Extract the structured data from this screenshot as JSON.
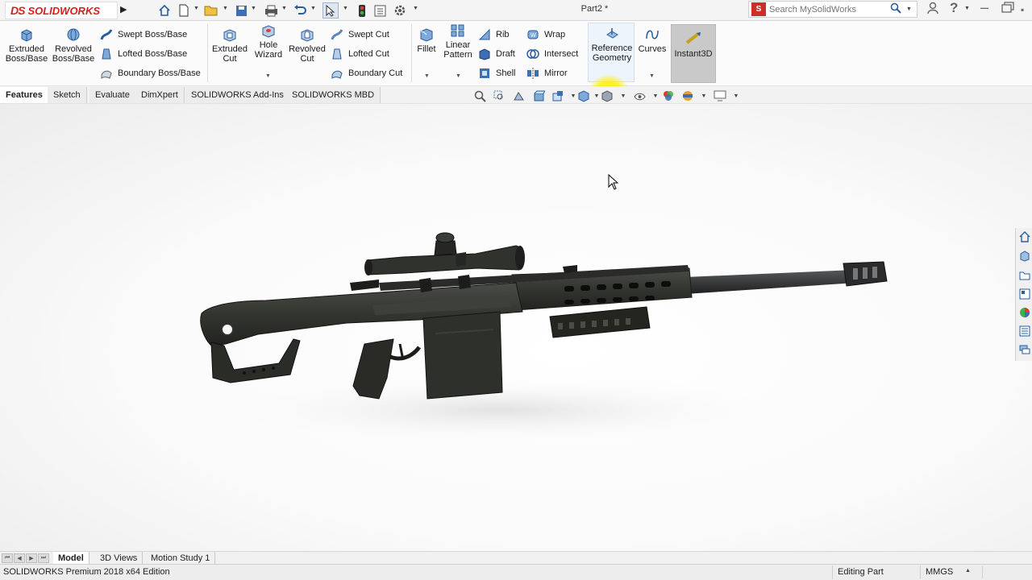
{
  "app": {
    "brand_prefix": "DS",
    "brand_name": "SOLIDWORKS",
    "doc_title": "Part2 *",
    "search_placeholder": "Search MySolidWorks"
  },
  "quick_access": [
    "home-icon",
    "new-document-icon",
    "open-folder-icon",
    "save-icon",
    "print-icon",
    "undo-icon",
    "select-arrow-icon",
    "rebuild-icon",
    "file-properties-icon",
    "options-gear-icon"
  ],
  "ribbon": {
    "extruded_boss": "Extruded Boss/Base",
    "revolved_boss": "Revolved Boss/Base",
    "swept_boss": "Swept Boss/Base",
    "lofted_boss": "Lofted Boss/Base",
    "boundary_boss": "Boundary Boss/Base",
    "extruded_cut": "Extruded Cut",
    "hole_wizard": "Hole Wizard",
    "revolved_cut": "Revolved Cut",
    "swept_cut": "Swept Cut",
    "lofted_cut": "Lofted Cut",
    "boundary_cut": "Boundary Cut",
    "fillet": "Fillet",
    "linear_pattern": "Linear Pattern",
    "rib": "Rib",
    "draft": "Draft",
    "shell": "Shell",
    "wrap": "Wrap",
    "intersect": "Intersect",
    "mirror": "Mirror",
    "reference_geometry": "Reference Geometry",
    "curves": "Curves",
    "instant3d": "Instant3D"
  },
  "command_tabs": [
    "Features",
    "Sketch",
    "Evaluate",
    "DimXpert",
    "SOLIDWORKS Add-Ins",
    "SOLIDWORKS MBD"
  ],
  "active_command_tab": "Features",
  "bottom_tabs": [
    "Model",
    "3D Views",
    "Motion Study 1"
  ],
  "active_bottom_tab": "Model",
  "status": {
    "edition": "SOLIDWORKS Premium 2018 x64 Edition",
    "mode": "Editing Part",
    "units": "MMGS"
  },
  "colors": {
    "brand_red": "#d42020",
    "highlight_yellow": "#fff000",
    "model_body": "#3a3c38"
  }
}
